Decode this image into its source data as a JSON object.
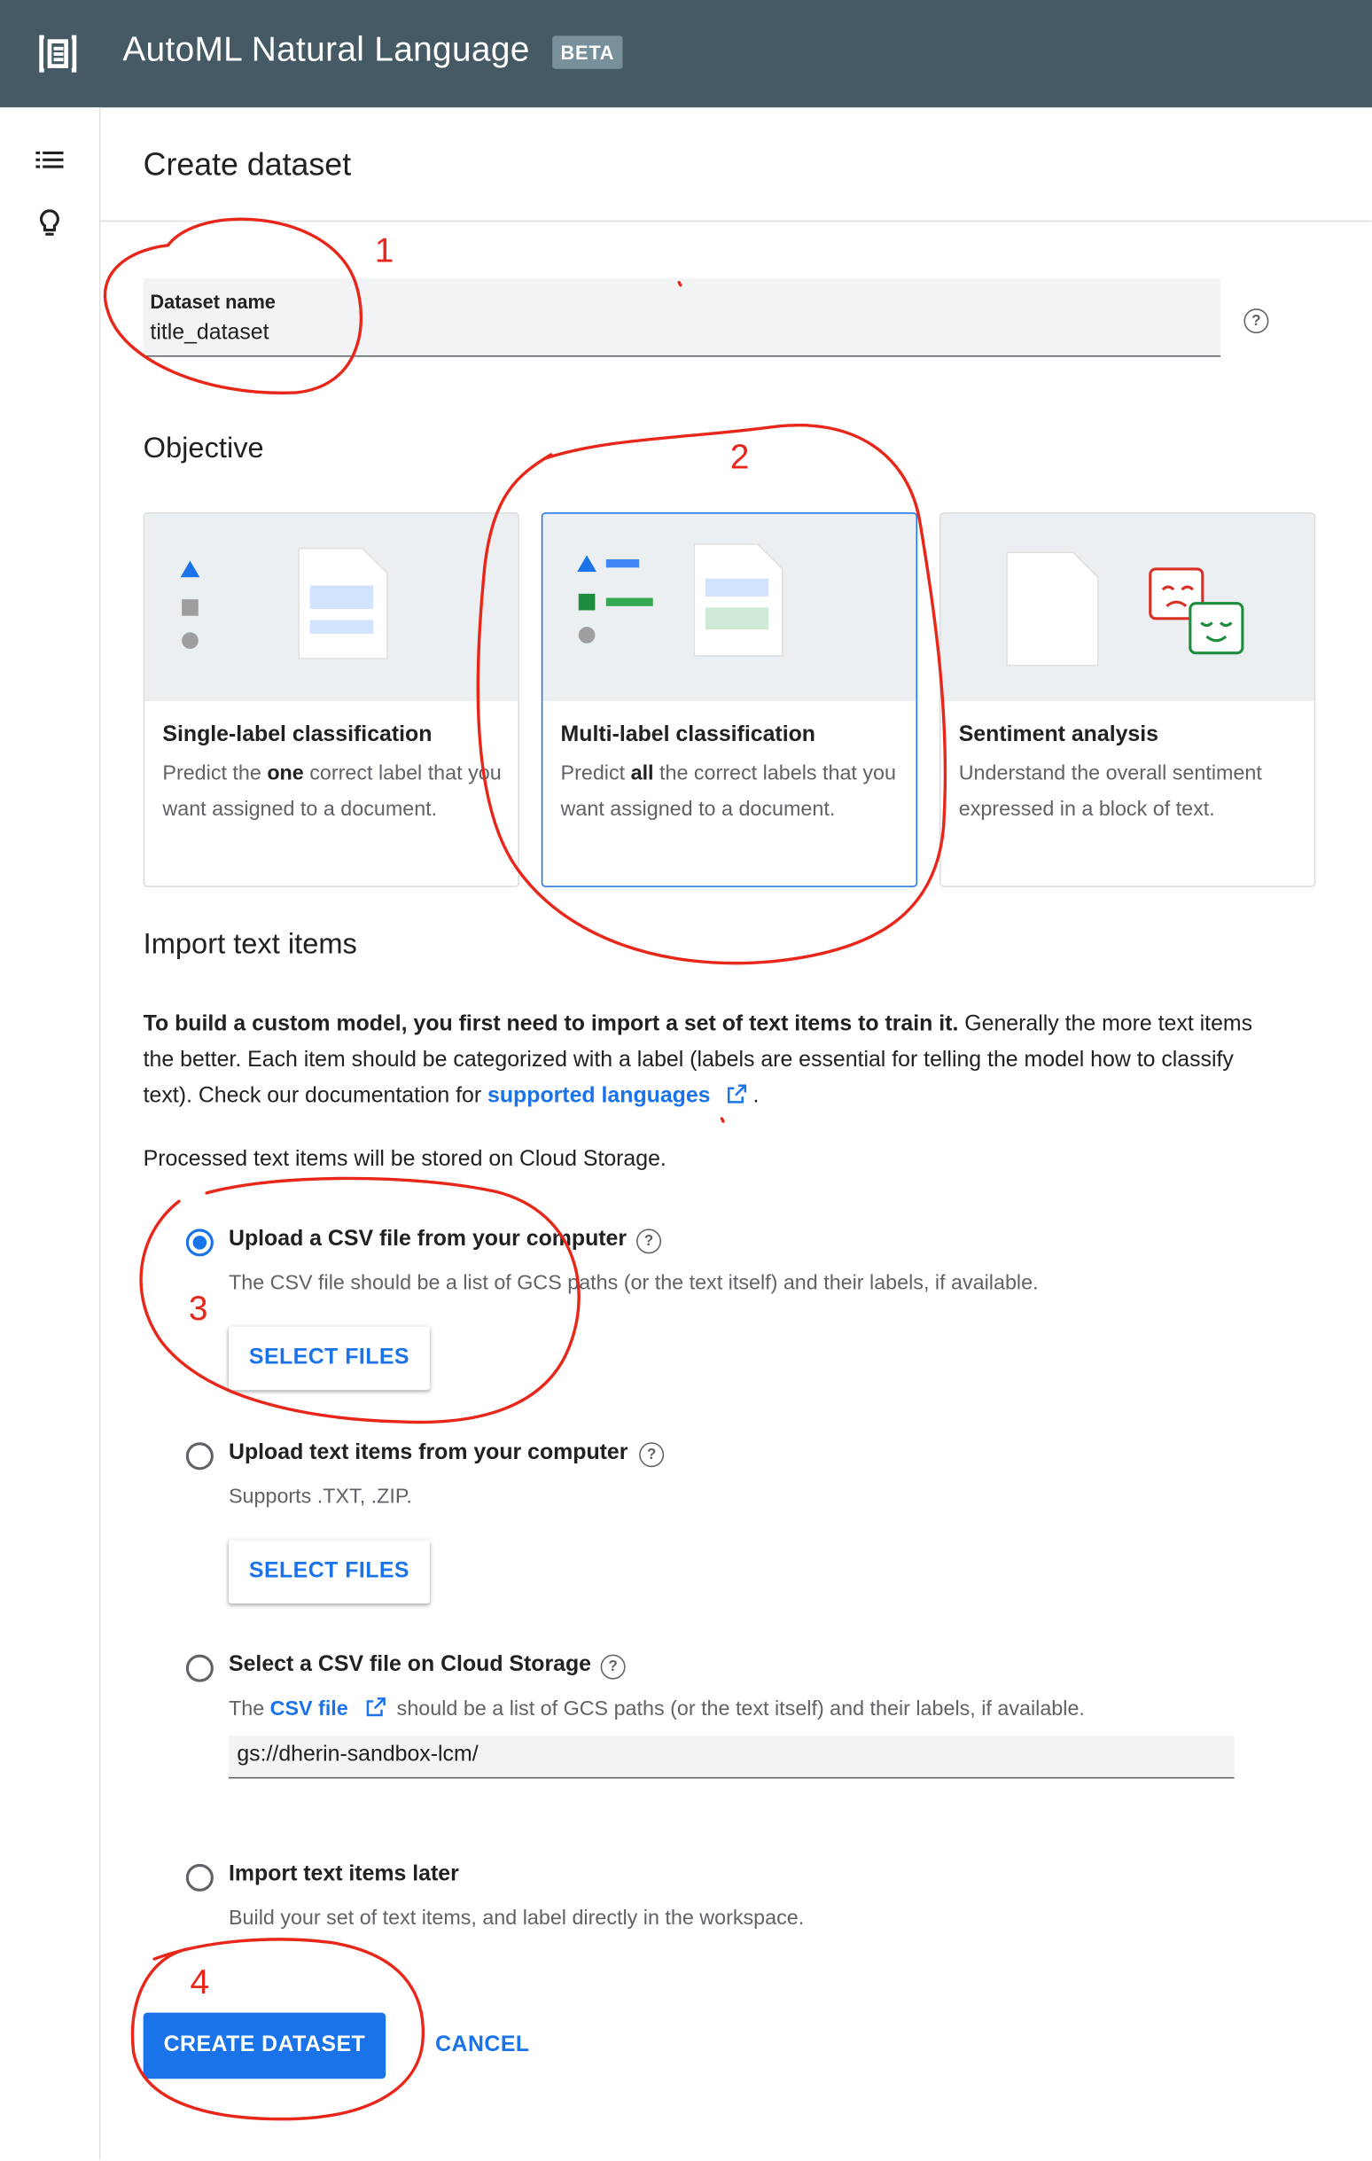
{
  "header": {
    "title": "AutoML Natural Language",
    "badge": "BETA"
  },
  "sidebar": {
    "icons": [
      "list-icon",
      "lightbulb-icon"
    ]
  },
  "page": {
    "title": "Create dataset"
  },
  "dataset_name": {
    "label": "Dataset name",
    "value": "title_dataset",
    "help": "?"
  },
  "objective": {
    "heading": "Objective",
    "cards": [
      {
        "title": "Single-label classification",
        "desc_pre": "Predict the ",
        "desc_em": "one",
        "desc_post": " correct label that you want assigned to a document."
      },
      {
        "title": "Multi-label classification",
        "desc_pre": "Predict ",
        "desc_em": "all",
        "desc_post": " the correct labels that you want assigned to a document.",
        "selected": true
      },
      {
        "title": "Sentiment analysis",
        "desc": "Understand the overall sentiment expressed in a block of text."
      }
    ]
  },
  "import": {
    "heading": "Import text items",
    "intro_bold": "To build a custom model, you first need to import a set of text items to train it.",
    "intro_rest": " Generally the more text items the better. Each item should be categorized with a label (labels are essential for telling the model how to classify text). Check our documentation for ",
    "intro_link": "supported languages",
    "intro_end": " .",
    "storage_note": "Processed text items will be stored on Cloud Storage.",
    "options": [
      {
        "title": "Upload a CSV file from your computer",
        "desc": "The CSV file should be a list of GCS paths (or the text itself) and their labels, if available.",
        "button": "SELECT FILES",
        "selected": true
      },
      {
        "title": "Upload text items from your computer",
        "desc": "Supports .TXT, .ZIP.",
        "button": "SELECT FILES"
      },
      {
        "title": "Select a CSV file on Cloud Storage",
        "desc_pre": "The ",
        "desc_link": "CSV file",
        "desc_post": " should be a list of GCS paths (or the text itself) and their labels, if available.",
        "input_value": "gs://dherin-sandbox-lcm/"
      },
      {
        "title": "Import text items later",
        "desc": "Build your set of text items, and label directly in the workspace."
      }
    ]
  },
  "actions": {
    "create": "CREATE DATASET",
    "cancel": "CANCEL"
  },
  "annotations": [
    "1",
    "2",
    "3",
    "4"
  ],
  "colors": {
    "header": "#455a64",
    "accent": "#1a73e8",
    "annotation": "#e8271a"
  }
}
